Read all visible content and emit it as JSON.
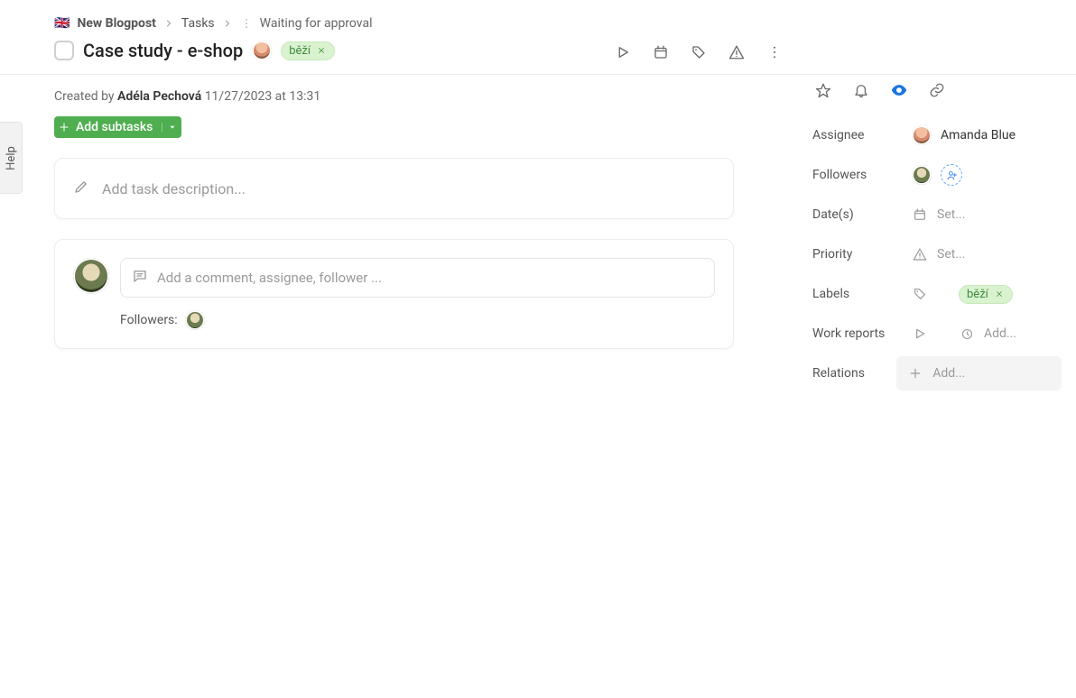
{
  "breadcrumb": {
    "flag": "🇬🇧",
    "project": "New Blogpost",
    "tasks": "Tasks",
    "status": "Waiting for approval"
  },
  "task": {
    "title": "Case study - e-shop",
    "label": "běží"
  },
  "meta": {
    "created_by_prefix": "Created by ",
    "author": "Adéla Pechová",
    "timestamp": " 11/27/2023 at 13:31"
  },
  "buttons": {
    "add_subtasks": "Add subtasks"
  },
  "placeholders": {
    "description": "Add task description...",
    "comment": "Add a comment, assignee, follower ..."
  },
  "comment_area": {
    "followers_label": "Followers:"
  },
  "props": {
    "assignee_label": "Assignee",
    "assignee_name": "Amanda Blue",
    "followers_label": "Followers",
    "dates_label": "Date(s)",
    "dates_value": "Set...",
    "priority_label": "Priority",
    "priority_value": "Set...",
    "labels_label": "Labels",
    "labels_value": "běží",
    "work_reports_label": "Work reports",
    "work_reports_value": "Add...",
    "relations_label": "Relations",
    "relations_value": "Add..."
  },
  "help_tab": "Help"
}
